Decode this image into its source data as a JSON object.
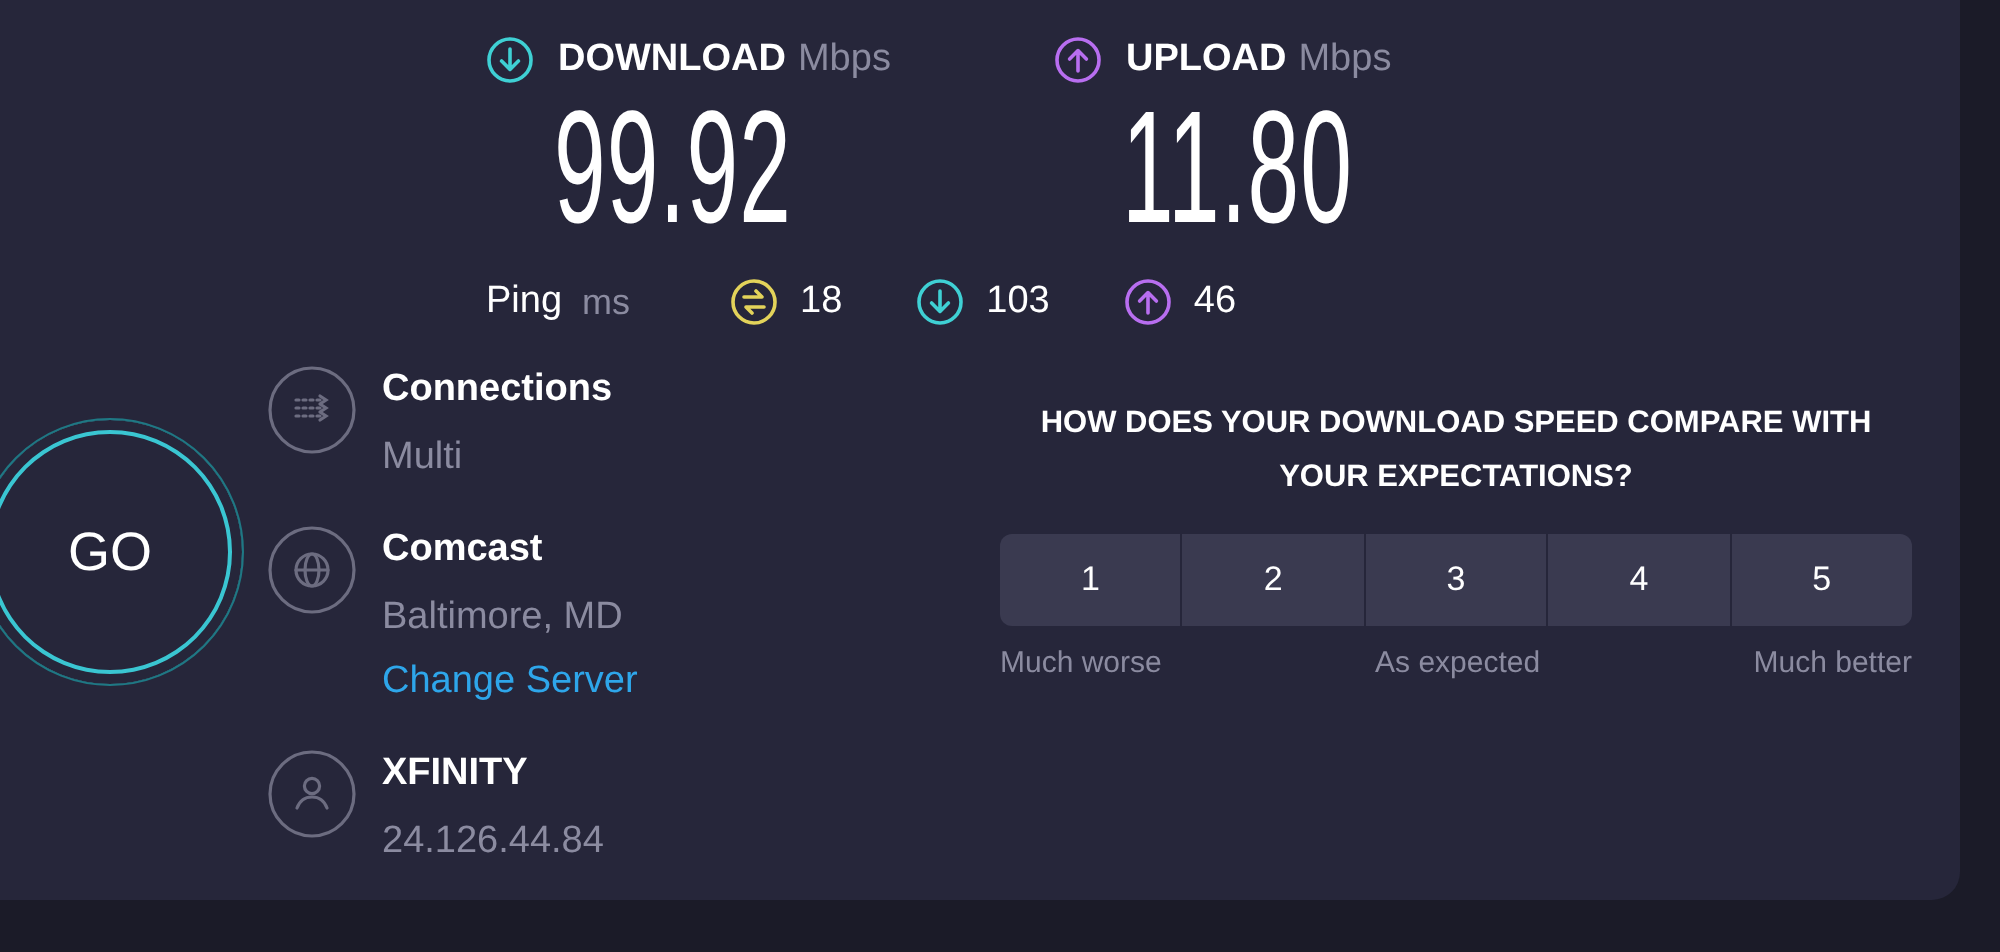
{
  "download": {
    "label": "DOWNLOAD",
    "unit": "Mbps",
    "value": "99.92"
  },
  "upload": {
    "label": "UPLOAD",
    "unit": "Mbps",
    "value": "11.80"
  },
  "ping": {
    "label": "Ping",
    "unit": "ms",
    "readings": [
      {
        "kind": "idle",
        "value": "18"
      },
      {
        "kind": "download",
        "value": "103"
      },
      {
        "kind": "upload",
        "value": "46"
      }
    ]
  },
  "go_button": {
    "label": "GO"
  },
  "details": [
    {
      "kind": "connections",
      "title": "Connections",
      "value": "Multi"
    },
    {
      "kind": "server",
      "title": "Comcast",
      "value": "Baltimore, MD",
      "link": "Change Server"
    },
    {
      "kind": "provider",
      "title": "XFINITY",
      "value": "24.126.44.84"
    }
  ],
  "survey": {
    "question": "HOW DOES YOUR DOWNLOAD SPEED COMPARE WITH YOUR EXPECTATIONS?",
    "options": [
      {
        "label": "1",
        "selected": false
      },
      {
        "label": "2",
        "selected": false
      },
      {
        "label": "3",
        "selected": false
      },
      {
        "label": "4",
        "selected": false
      },
      {
        "label": "5",
        "selected": false
      }
    ],
    "scale_labels": [
      "Much worse",
      "As expected",
      "Much better"
    ]
  }
}
